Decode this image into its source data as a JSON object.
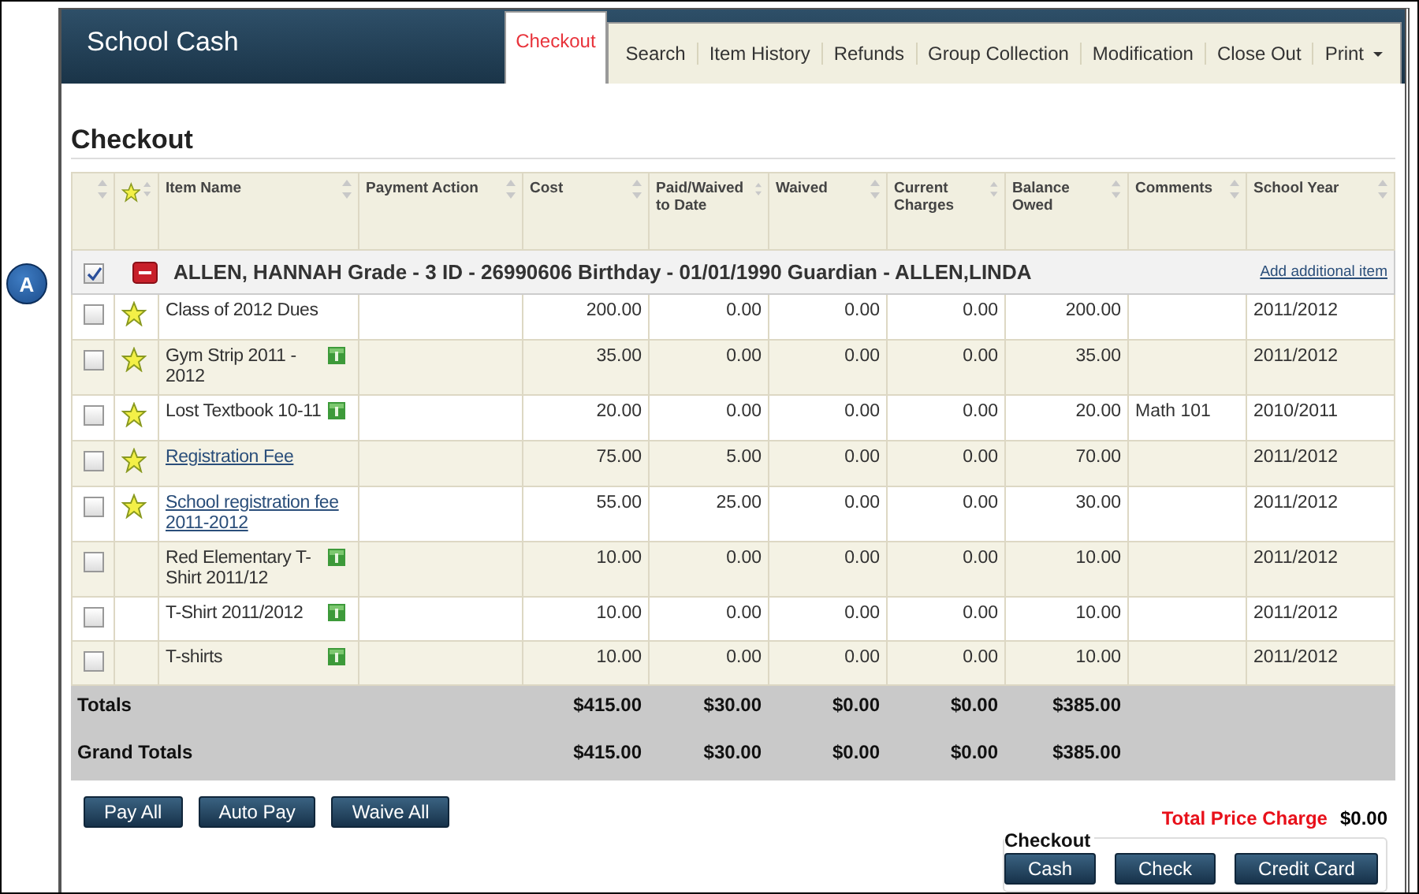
{
  "app": {
    "title": "School Cash"
  },
  "tabs": [
    {
      "label": "Checkout",
      "selected": true,
      "kind": "plain"
    },
    {
      "label": "Search",
      "selected": false,
      "kind": "plain"
    },
    {
      "label": "Item History",
      "selected": false,
      "kind": "plain"
    },
    {
      "label": "Refunds",
      "selected": false,
      "kind": "plain"
    },
    {
      "label": "Group Collection",
      "selected": false,
      "kind": "plain"
    },
    {
      "label": "Modification",
      "selected": false,
      "kind": "plain"
    },
    {
      "label": "Close Out",
      "selected": false,
      "kind": "plain"
    },
    {
      "label": "Print",
      "selected": false,
      "kind": "dropdown"
    }
  ],
  "page_title": "Checkout",
  "callout": {
    "label": "A"
  },
  "table": {
    "columns": [
      {
        "kind": "blank"
      },
      {
        "kind": "star"
      },
      {
        "kind": "text",
        "label": "Item Name"
      },
      {
        "kind": "text",
        "label": "Payment Action"
      },
      {
        "kind": "text",
        "label": "Cost"
      },
      {
        "kind": "text",
        "label": "Paid/Waived to Date"
      },
      {
        "kind": "text",
        "label": "Waived"
      },
      {
        "kind": "text",
        "label": "Current Charges"
      },
      {
        "kind": "text",
        "label": "Balance Owed"
      },
      {
        "kind": "text",
        "label": "Comments"
      },
      {
        "kind": "text",
        "label": "School Year"
      }
    ],
    "student": {
      "checked": true,
      "expanded": true,
      "text": "ALLEN, HANNAH Grade - 3 ID - 26990606 Birthday - 01/01/1990 Guardian - ALLEN,LINDA",
      "link": "Add additional item"
    },
    "rows": [
      {
        "checked": false,
        "starred": true,
        "kind": "text",
        "item": "Class of 2012 Dues",
        "dollar": false,
        "cost": "200.00",
        "paid": "0.00",
        "waived": "0.00",
        "current": "0.00",
        "balance": "200.00",
        "year": "2011/2012"
      },
      {
        "checked": false,
        "starred": true,
        "kind": "text",
        "item": "Gym Strip 2011 - 2012",
        "dollar": true,
        "cost": "35.00",
        "paid": "0.00",
        "waived": "0.00",
        "current": "0.00",
        "balance": "35.00",
        "year": "2011/2012"
      },
      {
        "checked": false,
        "starred": true,
        "kind": "text",
        "item": "Lost Textbook 10-11",
        "dollar": true,
        "cost": "20.00",
        "paid": "0.00",
        "waived": "0.00",
        "current": "0.00",
        "balance": "20.00",
        "comments": "Math 101",
        "year": "2010/2011"
      },
      {
        "checked": false,
        "starred": true,
        "kind": "link",
        "item": "Registration Fee",
        "dollar": false,
        "cost": "75.00",
        "paid": "5.00",
        "waived": "0.00",
        "current": "0.00",
        "balance": "70.00",
        "year": "2011/2012"
      },
      {
        "checked": false,
        "starred": true,
        "kind": "link",
        "item": "School registration fee 2011-2012",
        "dollar": false,
        "cost": "55.00",
        "paid": "25.00",
        "waived": "0.00",
        "current": "0.00",
        "balance": "30.00",
        "year": "2011/2012"
      },
      {
        "checked": false,
        "starred": false,
        "kind": "text",
        "item": "Red Elementary T-Shirt 2011/12",
        "dollar": true,
        "cost": "10.00",
        "paid": "0.00",
        "waived": "0.00",
        "current": "0.00",
        "balance": "10.00",
        "year": "2011/2012"
      },
      {
        "checked": false,
        "starred": false,
        "kind": "text",
        "item": "T-Shirt 2011/2012",
        "dollar": true,
        "cost": "10.00",
        "paid": "0.00",
        "waived": "0.00",
        "current": "0.00",
        "balance": "10.00",
        "year": "2011/2012"
      },
      {
        "checked": false,
        "starred": false,
        "kind": "text",
        "item": "T-shirts",
        "dollar": true,
        "cost": "10.00",
        "paid": "0.00",
        "waived": "0.00",
        "current": "0.00",
        "balance": "10.00",
        "year": "2011/2012"
      }
    ],
    "totals": [
      {
        "label": "Totals",
        "cost": "$415.00",
        "paid": "$30.00",
        "waived": "$0.00",
        "current": "$0.00",
        "balance": "$385.00"
      },
      {
        "label": "Grand Totals",
        "cost": "$415.00",
        "paid": "$30.00",
        "waived": "$0.00",
        "current": "$0.00",
        "balance": "$385.00"
      }
    ]
  },
  "actions": [
    "Pay All",
    "Auto Pay",
    "Waive All"
  ],
  "total_price": {
    "label": "Total Price Charge",
    "value": "$0.00"
  },
  "checkout": {
    "title": "Checkout",
    "buttons": [
      "Cash",
      "Check",
      "Credit Card"
    ]
  }
}
